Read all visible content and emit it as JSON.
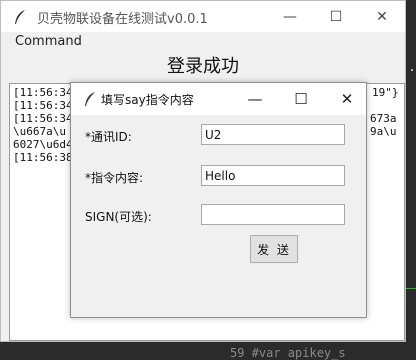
{
  "main_window": {
    "title": "贝壳物联设备在线测试v0.0.1",
    "controls": {
      "minimize": "—",
      "maximize": "☐",
      "close": "✕"
    },
    "menu": [
      "Command"
    ],
    "status_label": "登录成功",
    "log_lines": [
      "[11:56:34",
      "[11:56:34",
      "[11:56:34",
      "\\u667a\\u",
      "6027\\u6d4",
      "[11:56:38",
      "19\"}",
      "673a",
      "9a\\u"
    ]
  },
  "dialog": {
    "title": "填写say指令内容",
    "controls": {
      "minimize": "—",
      "maximize": "☐",
      "close": "✕"
    },
    "fields": [
      {
        "label": "*通讯ID:",
        "value": "U2"
      },
      {
        "label": "*指令内容:",
        "value": "Hello"
      },
      {
        "label": "SIGN(可选):",
        "value": ""
      }
    ],
    "send_label": "发 送"
  },
  "background_editor": {
    "bottom_line": "59   #var apikey_s"
  }
}
